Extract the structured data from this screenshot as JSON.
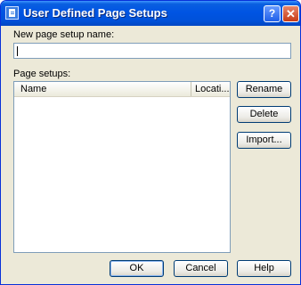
{
  "window": {
    "title": "User Defined Page Setups",
    "help_glyph": "?",
    "close_glyph": "✕"
  },
  "form": {
    "new_name_label": "New page setup name:",
    "new_name_value": "",
    "page_setups_label": "Page setups:"
  },
  "list": {
    "columns": [
      "Name",
      "Locati..."
    ],
    "rows": []
  },
  "side_buttons": {
    "rename": "Rename",
    "delete": "Delete",
    "import": "Import..."
  },
  "bottom_buttons": {
    "ok": "OK",
    "cancel": "Cancel",
    "help": "Help"
  }
}
